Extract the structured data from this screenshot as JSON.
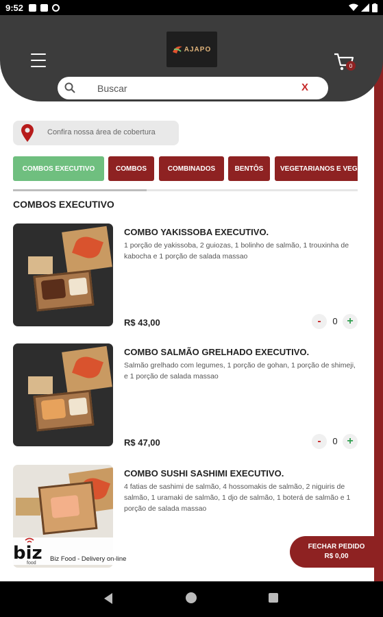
{
  "status_bar": {
    "time": "9:52"
  },
  "header": {
    "logo_text": "AJAPO",
    "cart_count": "0"
  },
  "search": {
    "placeholder": "Buscar",
    "clear_label": "X"
  },
  "coverage": {
    "label": "Confira nossa área de cobertura"
  },
  "tabs": [
    {
      "label": "COMBOS EXECUTIVO",
      "active": true
    },
    {
      "label": "COMBOS",
      "active": false
    },
    {
      "label": "COMBINADOS",
      "active": false
    },
    {
      "label": "BENTÔS",
      "active": false
    },
    {
      "label": "VEGETARIANOS E VEG",
      "active": false
    }
  ],
  "section": {
    "title": "COMBOS EXECUTIVO"
  },
  "products": [
    {
      "name": "COMBO YAKISSOBA EXECUTIVO.",
      "description": "1 porção de yakissoba, 2 guiozas, 1 bolinho de salmão, 1 trouxinha de kabocha e 1 porção de salada massao",
      "price": "R$ 43,00",
      "quantity": "0"
    },
    {
      "name": "COMBO SALMÃO GRELHADO EXECUTIVO.",
      "description": "Salmão grelhado com legumes, 1 porção de gohan, 1 porção de shimeji, e 1 porção de salada massao",
      "price": "R$ 47,00",
      "quantity": "0"
    },
    {
      "name": "COMBO SUSHI SASHIMI EXECUTIVO.",
      "description": "4 fatias de sashimi de salmão, 4 hossomakis de salmão, 2 niguiris de salmão, 1 uramaki de salmão, 1 djo de salmão, 1 boterá de salmão e 1 porção de salada massao",
      "price": "",
      "quantity": ""
    }
  ],
  "footer": {
    "brand": "biz",
    "brand_sub": "food",
    "tagline": "Biz Food - Delivery on-line"
  },
  "checkout": {
    "label": "FECHAR PEDIDO",
    "total": "R$ 0,00"
  },
  "colors": {
    "brand_red": "#8e2222",
    "active_tab": "#6fbf7f",
    "header": "#3c3c3c"
  }
}
